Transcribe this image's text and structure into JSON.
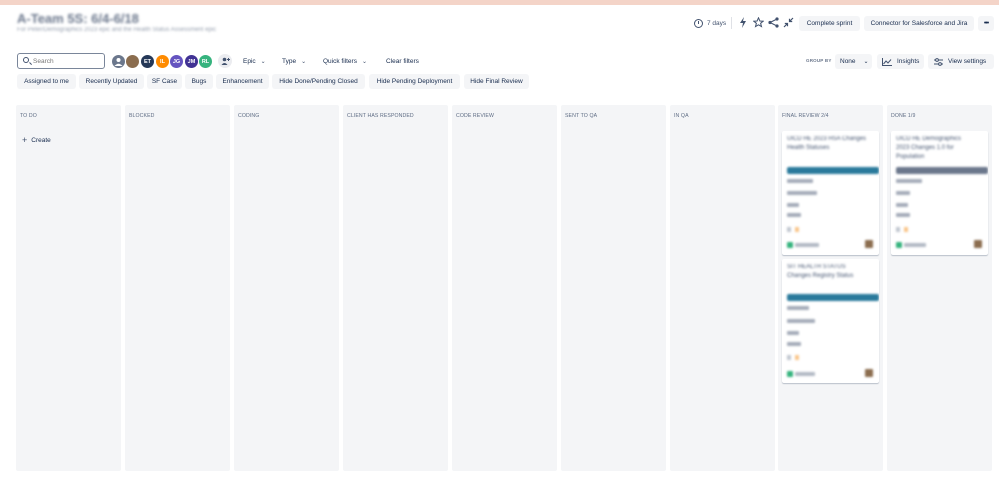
{
  "board": {
    "title": "A-Team 5S: 6/4-6/18",
    "subtitle": "For Peter/Demographics 2023 epic and the Health Status Assessment epic"
  },
  "header": {
    "days_label": "7 days",
    "complete_sprint_label": "Complete sprint",
    "connector_label": "Connector for Salesforce and Jira",
    "more_label": "•••"
  },
  "toolbar": {
    "search_placeholder": "Search",
    "avatars": [
      {
        "initials": "",
        "color": "#6b778c"
      },
      {
        "initials": "",
        "color": "#8b6d4f"
      },
      {
        "initials": "ET",
        "color": "#253858"
      },
      {
        "initials": "IL",
        "color": "#ff8b00"
      },
      {
        "initials": "JG",
        "color": "#6554c0"
      },
      {
        "initials": "JM",
        "color": "#403294"
      },
      {
        "initials": "RL",
        "color": "#36b37e"
      }
    ],
    "epic_label": "Epic",
    "type_label": "Type",
    "quick_filters_label": "Quick filters",
    "clear_filters_label": "Clear filters",
    "group_by_label": "GROUP BY",
    "group_by_value": "None",
    "insights_label": "Insights",
    "view_settings_label": "View settings"
  },
  "quick_chips": [
    "Assigned to me",
    "Recently Updated",
    "SF Case",
    "Bugs",
    "Enhancement",
    "Hide Done/Pending Closed",
    "Hide Pending Deployment",
    "Hide Final Review"
  ],
  "columns": [
    {
      "title": "TO DO"
    },
    {
      "title": "BLOCKED"
    },
    {
      "title": "CODING"
    },
    {
      "title": "CLIENT HAS RESPONDED"
    },
    {
      "title": "CODE REVIEW"
    },
    {
      "title": "SENT TO QA"
    },
    {
      "title": "IN QA"
    },
    {
      "title": "FINAL REVIEW 2/4"
    },
    {
      "title": "DONE 1/9"
    }
  ],
  "create_label": "Create",
  "cards": {
    "final_review_1": {
      "summary": "UICD HE 2023 HSA Changes Health Statuses",
      "epic_color": "#2a7a9c"
    },
    "done_1": {
      "summary": "UICD HE Demographics 2023 Changes 1.0 for Population",
      "epic_color": "#6b778c"
    },
    "final_review_2": {
      "summary": "SIT HEALTH STATUS Changes Registry Status",
      "epic_color": "#2a7a9c"
    }
  },
  "colors": {
    "accent": "#0052cc",
    "column_bg": "#f4f5f7",
    "epic_teal": "#2a7a9c",
    "epic_gray": "#6b778c"
  },
  "icons": [
    "clock-icon",
    "lightning-icon",
    "star-icon",
    "share-icon",
    "minimize-icon",
    "search-icon",
    "add-person-icon",
    "insights-icon",
    "settings-icon",
    "plus-icon"
  ]
}
